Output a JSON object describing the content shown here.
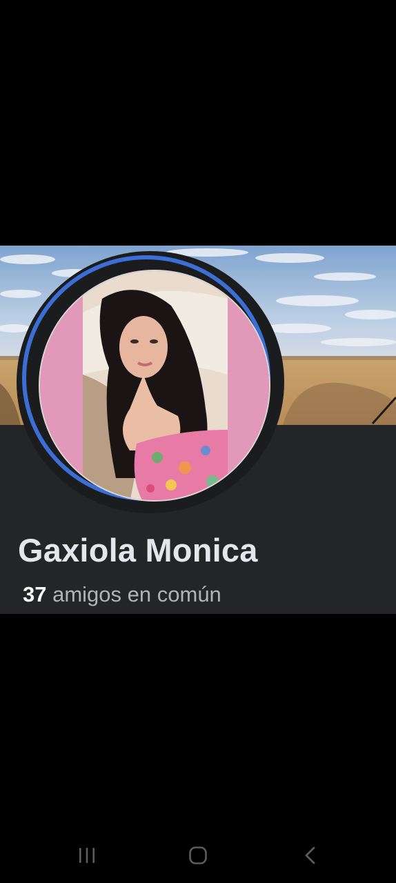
{
  "profile": {
    "name": "Gaxiola Monica",
    "mutual_friends_count": "37",
    "mutual_friends_label": "amigos en común"
  },
  "colors": {
    "card_background": "#242526",
    "avatar_ring": "#3b6fd6",
    "name_text": "#e4e6eb",
    "secondary_text": "#b0b3b8"
  },
  "nav_bar": {
    "recents_icon": "recents-icon",
    "home_icon": "home-icon",
    "back_icon": "back-icon"
  }
}
